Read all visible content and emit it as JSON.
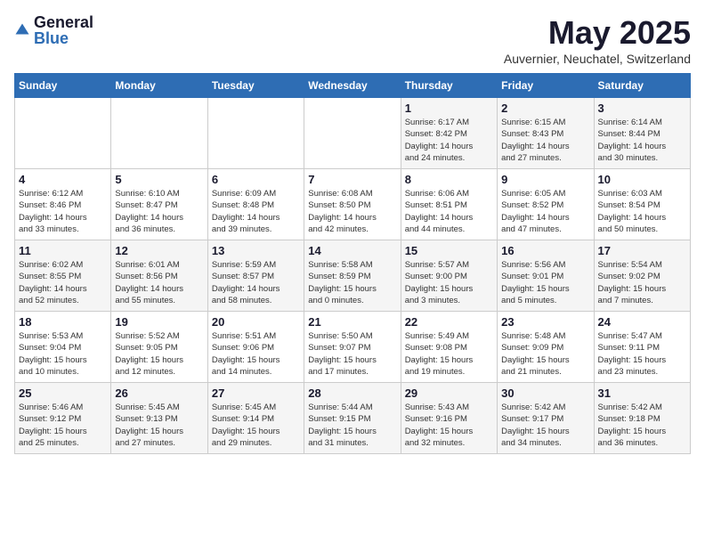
{
  "logo": {
    "general": "General",
    "blue": "Blue"
  },
  "title": "May 2025",
  "subtitle": "Auvernier, Neuchatel, Switzerland",
  "days_of_week": [
    "Sunday",
    "Monday",
    "Tuesday",
    "Wednesday",
    "Thursday",
    "Friday",
    "Saturday"
  ],
  "weeks": [
    [
      {
        "day": "",
        "info": ""
      },
      {
        "day": "",
        "info": ""
      },
      {
        "day": "",
        "info": ""
      },
      {
        "day": "",
        "info": ""
      },
      {
        "day": "1",
        "info": "Sunrise: 6:17 AM\nSunset: 8:42 PM\nDaylight: 14 hours\nand 24 minutes."
      },
      {
        "day": "2",
        "info": "Sunrise: 6:15 AM\nSunset: 8:43 PM\nDaylight: 14 hours\nand 27 minutes."
      },
      {
        "day": "3",
        "info": "Sunrise: 6:14 AM\nSunset: 8:44 PM\nDaylight: 14 hours\nand 30 minutes."
      }
    ],
    [
      {
        "day": "4",
        "info": "Sunrise: 6:12 AM\nSunset: 8:46 PM\nDaylight: 14 hours\nand 33 minutes."
      },
      {
        "day": "5",
        "info": "Sunrise: 6:10 AM\nSunset: 8:47 PM\nDaylight: 14 hours\nand 36 minutes."
      },
      {
        "day": "6",
        "info": "Sunrise: 6:09 AM\nSunset: 8:48 PM\nDaylight: 14 hours\nand 39 minutes."
      },
      {
        "day": "7",
        "info": "Sunrise: 6:08 AM\nSunset: 8:50 PM\nDaylight: 14 hours\nand 42 minutes."
      },
      {
        "day": "8",
        "info": "Sunrise: 6:06 AM\nSunset: 8:51 PM\nDaylight: 14 hours\nand 44 minutes."
      },
      {
        "day": "9",
        "info": "Sunrise: 6:05 AM\nSunset: 8:52 PM\nDaylight: 14 hours\nand 47 minutes."
      },
      {
        "day": "10",
        "info": "Sunrise: 6:03 AM\nSunset: 8:54 PM\nDaylight: 14 hours\nand 50 minutes."
      }
    ],
    [
      {
        "day": "11",
        "info": "Sunrise: 6:02 AM\nSunset: 8:55 PM\nDaylight: 14 hours\nand 52 minutes."
      },
      {
        "day": "12",
        "info": "Sunrise: 6:01 AM\nSunset: 8:56 PM\nDaylight: 14 hours\nand 55 minutes."
      },
      {
        "day": "13",
        "info": "Sunrise: 5:59 AM\nSunset: 8:57 PM\nDaylight: 14 hours\nand 58 minutes."
      },
      {
        "day": "14",
        "info": "Sunrise: 5:58 AM\nSunset: 8:59 PM\nDaylight: 15 hours\nand 0 minutes."
      },
      {
        "day": "15",
        "info": "Sunrise: 5:57 AM\nSunset: 9:00 PM\nDaylight: 15 hours\nand 3 minutes."
      },
      {
        "day": "16",
        "info": "Sunrise: 5:56 AM\nSunset: 9:01 PM\nDaylight: 15 hours\nand 5 minutes."
      },
      {
        "day": "17",
        "info": "Sunrise: 5:54 AM\nSunset: 9:02 PM\nDaylight: 15 hours\nand 7 minutes."
      }
    ],
    [
      {
        "day": "18",
        "info": "Sunrise: 5:53 AM\nSunset: 9:04 PM\nDaylight: 15 hours\nand 10 minutes."
      },
      {
        "day": "19",
        "info": "Sunrise: 5:52 AM\nSunset: 9:05 PM\nDaylight: 15 hours\nand 12 minutes."
      },
      {
        "day": "20",
        "info": "Sunrise: 5:51 AM\nSunset: 9:06 PM\nDaylight: 15 hours\nand 14 minutes."
      },
      {
        "day": "21",
        "info": "Sunrise: 5:50 AM\nSunset: 9:07 PM\nDaylight: 15 hours\nand 17 minutes."
      },
      {
        "day": "22",
        "info": "Sunrise: 5:49 AM\nSunset: 9:08 PM\nDaylight: 15 hours\nand 19 minutes."
      },
      {
        "day": "23",
        "info": "Sunrise: 5:48 AM\nSunset: 9:09 PM\nDaylight: 15 hours\nand 21 minutes."
      },
      {
        "day": "24",
        "info": "Sunrise: 5:47 AM\nSunset: 9:11 PM\nDaylight: 15 hours\nand 23 minutes."
      }
    ],
    [
      {
        "day": "25",
        "info": "Sunrise: 5:46 AM\nSunset: 9:12 PM\nDaylight: 15 hours\nand 25 minutes."
      },
      {
        "day": "26",
        "info": "Sunrise: 5:45 AM\nSunset: 9:13 PM\nDaylight: 15 hours\nand 27 minutes."
      },
      {
        "day": "27",
        "info": "Sunrise: 5:45 AM\nSunset: 9:14 PM\nDaylight: 15 hours\nand 29 minutes."
      },
      {
        "day": "28",
        "info": "Sunrise: 5:44 AM\nSunset: 9:15 PM\nDaylight: 15 hours\nand 31 minutes."
      },
      {
        "day": "29",
        "info": "Sunrise: 5:43 AM\nSunset: 9:16 PM\nDaylight: 15 hours\nand 32 minutes."
      },
      {
        "day": "30",
        "info": "Sunrise: 5:42 AM\nSunset: 9:17 PM\nDaylight: 15 hours\nand 34 minutes."
      },
      {
        "day": "31",
        "info": "Sunrise: 5:42 AM\nSunset: 9:18 PM\nDaylight: 15 hours\nand 36 minutes."
      }
    ]
  ]
}
